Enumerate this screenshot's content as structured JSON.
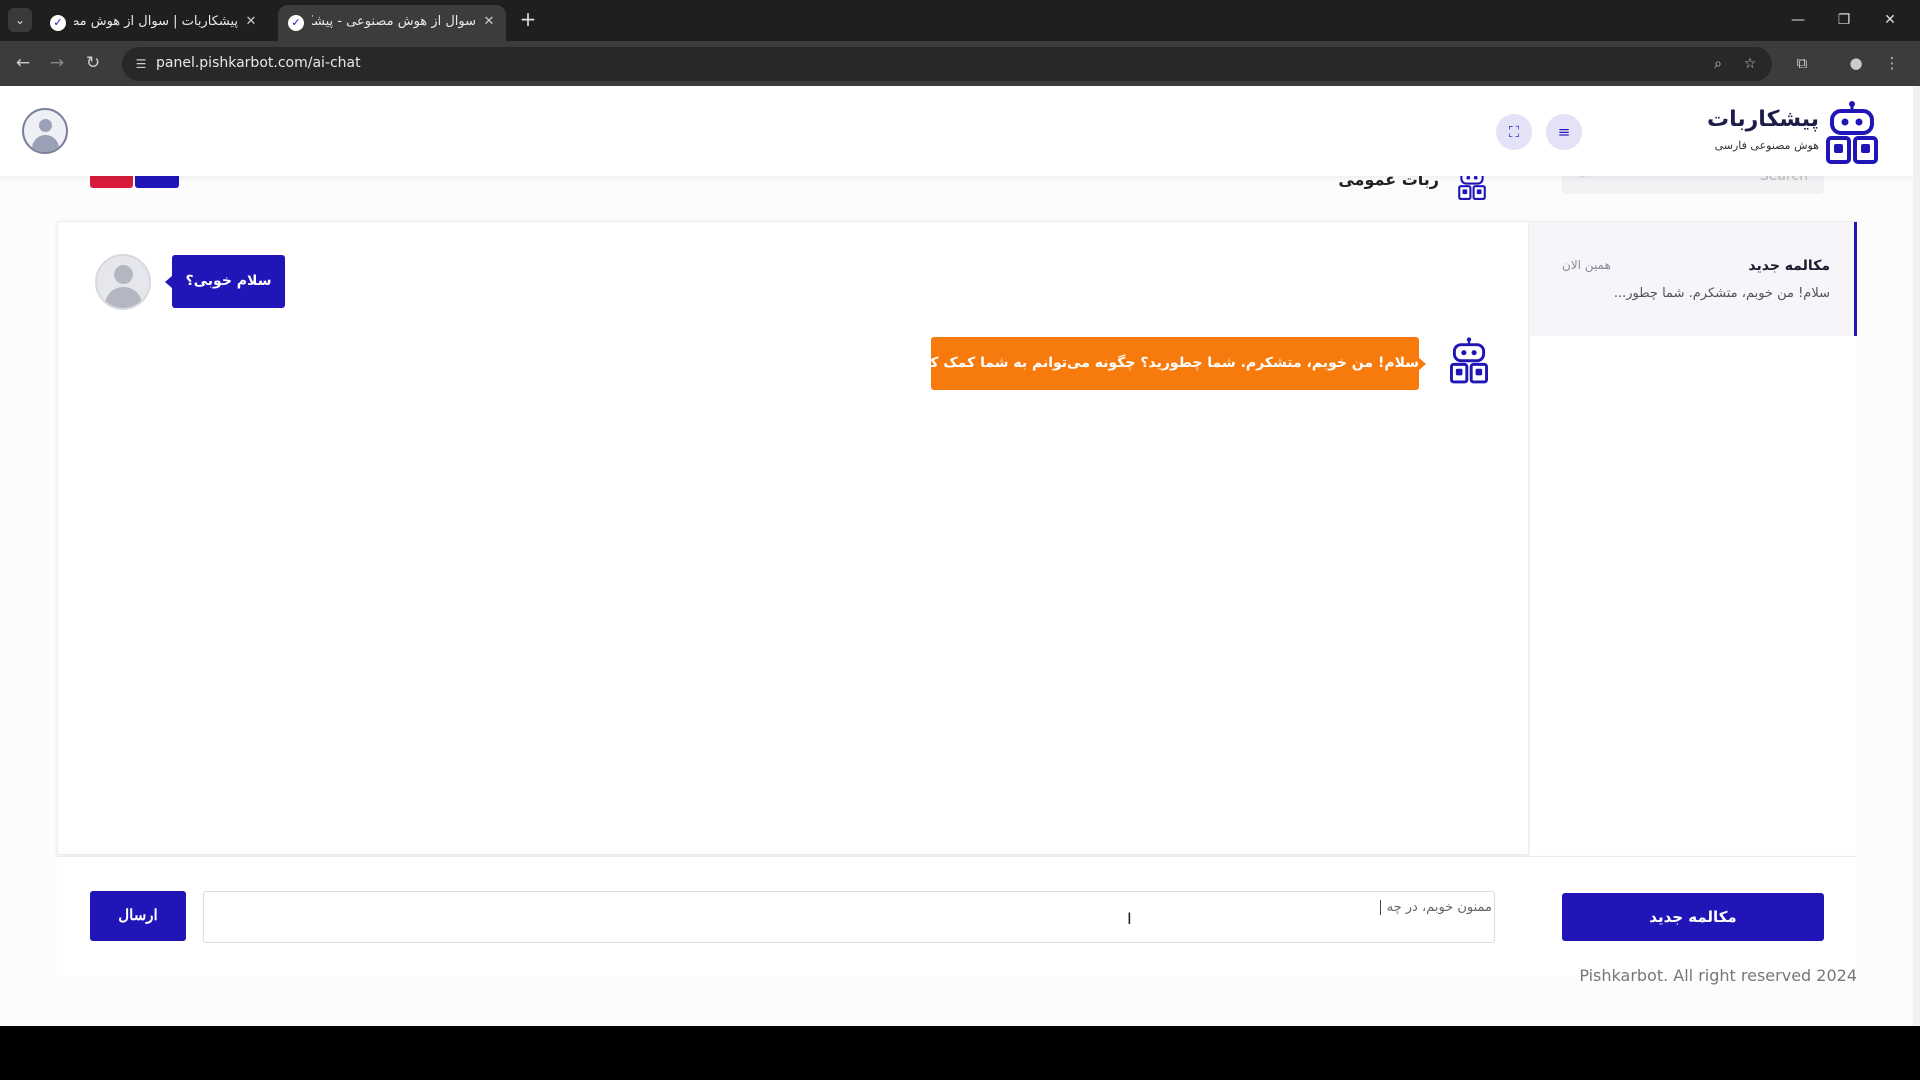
{
  "browser": {
    "tabs": [
      {
        "title": "پیشکاربات | سوال از هوش مصنوعی",
        "active": false
      },
      {
        "title": "سوال از هوش مصنوعی - پیشکاربات",
        "active": true
      }
    ],
    "url": "panel.pishkarbot.com/ai-chat",
    "favicon_glyph": "✓"
  },
  "header": {
    "brand_title": "پیشکاربات",
    "brand_subtitle": "هوش مصنوعی فارسی",
    "accent_color": "#2016b8"
  },
  "chat": {
    "bot_name": "ربات عمومی",
    "messages": [
      {
        "from": "user",
        "text": "سلام خوبی؟"
      },
      {
        "from": "bot",
        "text": "سلام! من خوبم، متشکرم. شما چطورید؟ چگونه می‌توانم به شما کمک کنم؟"
      }
    ],
    "user_bubble_color": "#2016b8",
    "bot_bubble_color": "#f77a0c"
  },
  "sidebar": {
    "search_placeholder": "Search",
    "conversations": [
      {
        "title": "مکالمه جدید",
        "time": "همین الان",
        "preview": "سلام! من خوبم، متشکرم. شما چطور..."
      }
    ],
    "new_conversation_label": "مکالمه جدید"
  },
  "composer": {
    "value": "ممنون خوبم، در چه",
    "send_label": "ارسال"
  },
  "footer": {
    "copyright": "Pishkarbot. All right reserved 2024"
  }
}
